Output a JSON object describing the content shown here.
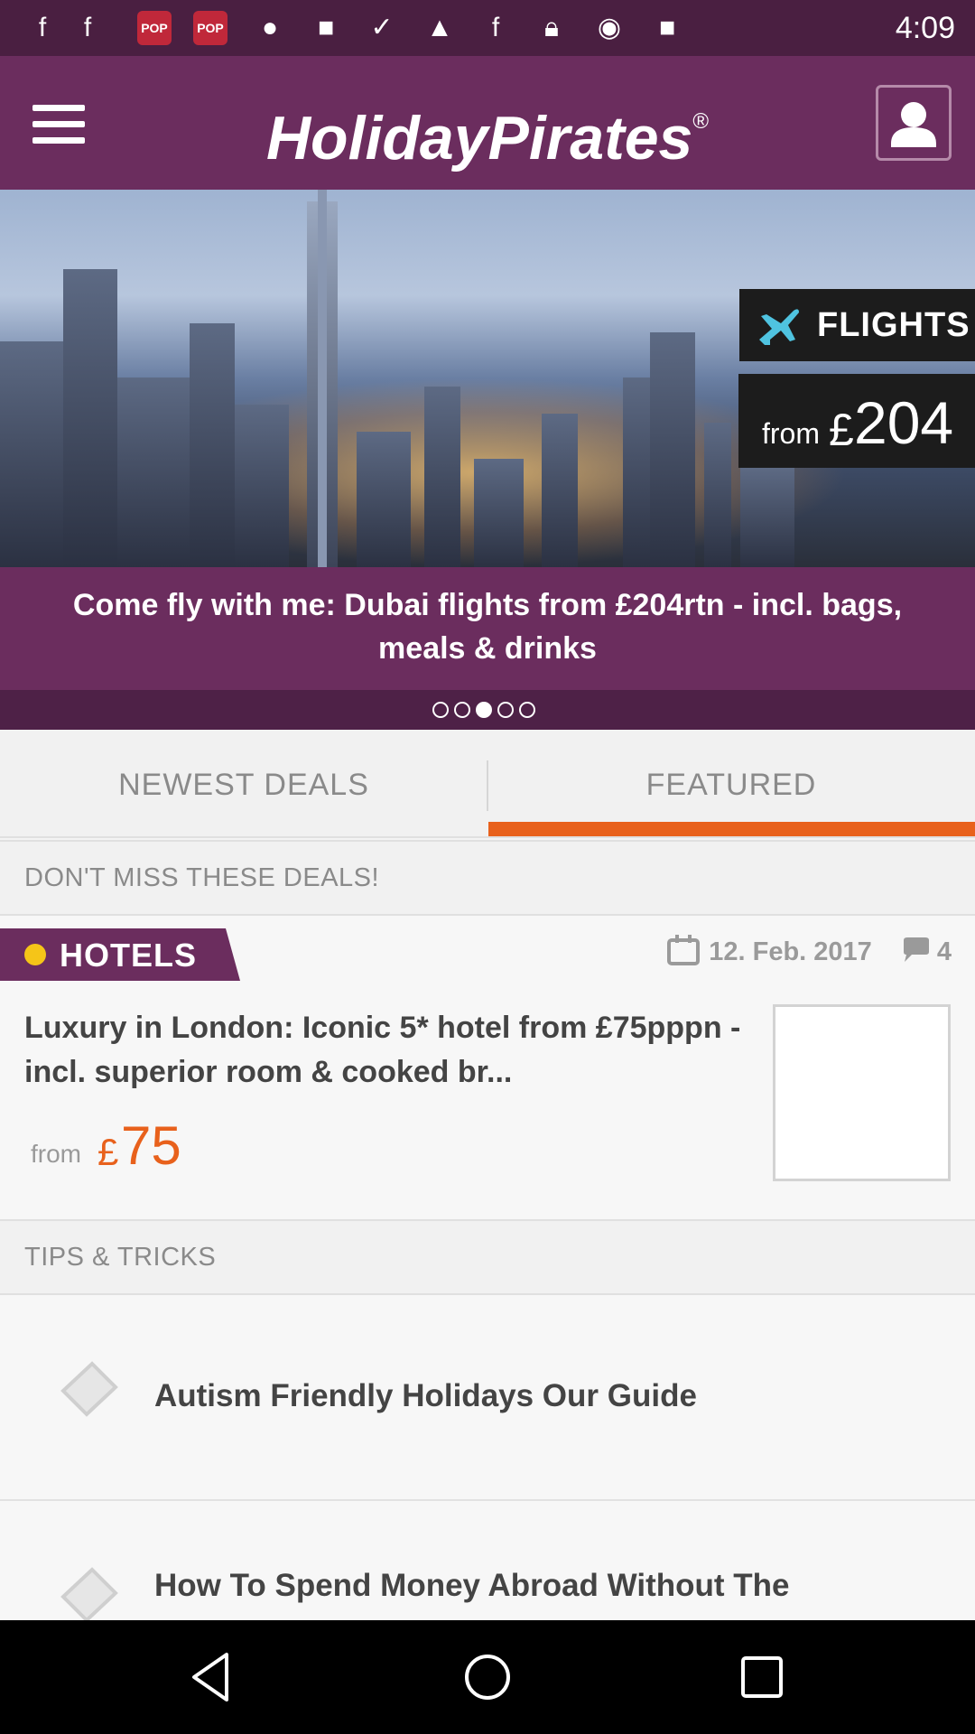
{
  "status_bar": {
    "time": "4:09",
    "icons": [
      "facebook-icon",
      "facebook-icon",
      "pop-app-icon",
      "pop-app-icon",
      "location-icon",
      "square-app-icon",
      "check-icon",
      "photo-icon",
      "facebook-icon",
      "lock-icon",
      "circle-icon",
      "game-icon"
    ]
  },
  "app_bar": {
    "logo": "HolidayPirates",
    "logo_mark": "®"
  },
  "hero": {
    "category": "FLIGHTS",
    "price_prefix": "from",
    "currency": "£",
    "price": "204",
    "caption": "Come fly with me: Dubai flights from £204rtn - incl. bags, meals & drinks",
    "pager": {
      "count": 5,
      "active": 2
    }
  },
  "tabs": [
    {
      "label": "NEWEST DEALS",
      "selected": false
    },
    {
      "label": "FEATURED",
      "selected": true
    }
  ],
  "colors": {
    "brand_purple": "#6b2d5e",
    "accent_orange": "#e8611c",
    "hotels_dot": "#f5c518"
  },
  "deals_section": {
    "header": "DON'T MISS THESE DEALS!",
    "deal": {
      "category": "HOTELS",
      "date": "12. Feb. 2017",
      "comments": "4",
      "title": "Luxury in London: Iconic 5* hotel from £75pppn - incl. superior room & cooked br...",
      "price_prefix": "from",
      "currency": "£",
      "price": "75"
    }
  },
  "tips_section": {
    "header": "TIPS & TRICKS",
    "items": [
      {
        "title": "Autism Friendly Holidays Our Guide"
      },
      {
        "title": "How To Spend Money Abroad Without The"
      }
    ]
  }
}
